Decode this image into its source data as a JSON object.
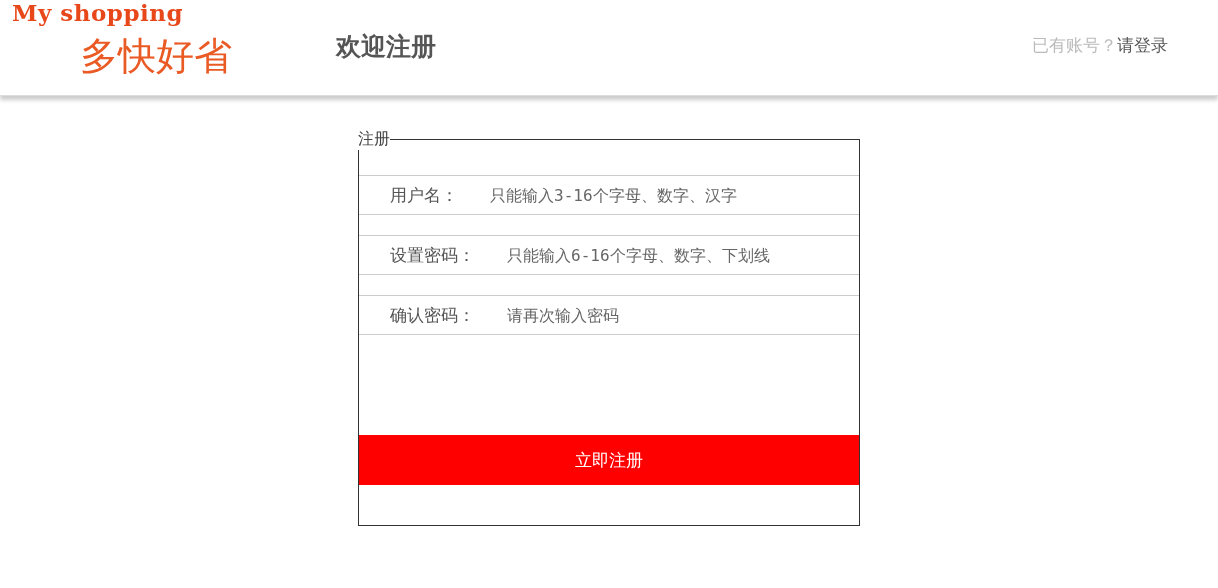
{
  "header": {
    "logo_text": "My shopping",
    "slogan": "多快好省",
    "title": "欢迎注册",
    "login_prompt": "已有账号？",
    "login_link": "请登录"
  },
  "form": {
    "legend": "注册",
    "fields": [
      {
        "label": "用户名：",
        "placeholder": "只能输入3-16个字母、数字、汉字"
      },
      {
        "label": "设置密码：",
        "placeholder": "只能输入6-16个字母、数字、下划线"
      },
      {
        "label": "确认密码：",
        "placeholder": "请再次输入密码"
      }
    ],
    "submit": "立即注册"
  }
}
